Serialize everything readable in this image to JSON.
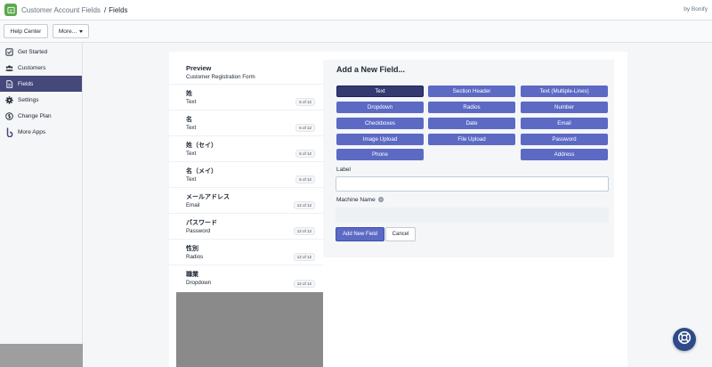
{
  "topbar": {
    "app_name": "Customer Account Fields",
    "separator": "/",
    "page_name": "Fields",
    "vendor": "by Bonify",
    "logo_icon": "app-logo-icon",
    "brand_color": "#5ba84e"
  },
  "actions": {
    "help_center": "Help Center",
    "more": "More..."
  },
  "sidebar": {
    "active_color": "#45487a",
    "items": [
      {
        "label": "Get Started",
        "icon": "checkbox-icon"
      },
      {
        "label": "Customers",
        "icon": "users-icon"
      },
      {
        "label": "Fields",
        "icon": "document-icon"
      },
      {
        "label": "Settings",
        "icon": "gear-icon"
      },
      {
        "label": "Change Plan",
        "icon": "dollar-icon"
      },
      {
        "label": "More Apps",
        "icon": "bonify-icon"
      }
    ]
  },
  "preview": {
    "title": "Preview",
    "subtitle": "Customer Registration Form",
    "fields": [
      {
        "name": "姓",
        "type": "Text",
        "badge": "6 of 12"
      },
      {
        "name": "名",
        "type": "Text",
        "badge": "6 of 12"
      },
      {
        "name": "姓（セイ）",
        "type": "Text",
        "badge": "6 of 12"
      },
      {
        "name": "名（メイ）",
        "type": "Text",
        "badge": "6 of 12"
      },
      {
        "name": "メールアドレス",
        "type": "Email",
        "badge": "12 of 12"
      },
      {
        "name": "パスワード",
        "type": "Password",
        "badge": "12 of 12"
      },
      {
        "name": "性別",
        "type": "Radios",
        "badge": "12 of 12"
      },
      {
        "name": "職業",
        "type": "Dropdown",
        "badge": "12 of 12"
      }
    ]
  },
  "add_field": {
    "title": "Add a New Field...",
    "button_color": "#5c6ac4",
    "types": {
      "text": "Text",
      "section_header": "Section Header",
      "text_multi": "Text (Multiple-Lines)",
      "dropdown": "Dropdown",
      "radios": "Radios",
      "number": "Number",
      "checkboxes": "Checkboxes",
      "date": "Date",
      "email": "Email",
      "image_upload": "Image Upload",
      "file_upload": "File Upload",
      "password": "Password",
      "phone": "Phone",
      "address": "Address"
    },
    "selected_type": "Text",
    "label_caption": "Label",
    "label_value": "",
    "machine_caption": "Machine Name",
    "machine_value": "",
    "submit": "Add New Field",
    "cancel": "Cancel"
  },
  "fab": {
    "icon": "lifebuoy-icon",
    "color": "#2f4a8a"
  }
}
